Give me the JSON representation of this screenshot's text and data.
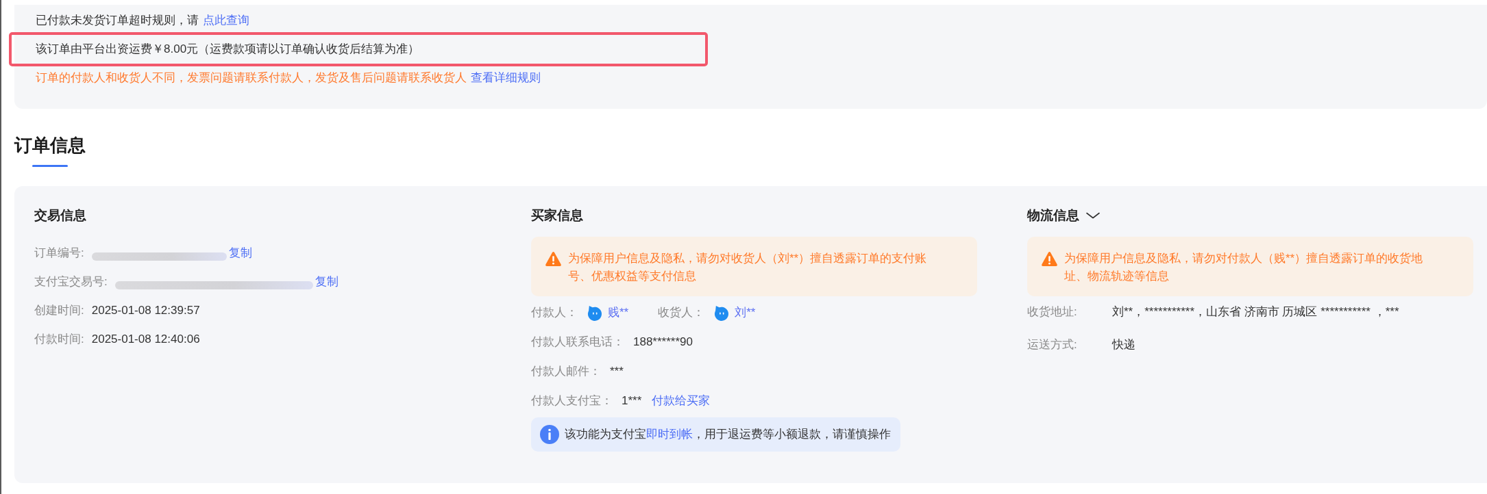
{
  "notice": {
    "lines": [
      {
        "text": "已付款未发货订单超时规则，请",
        "link": "点此查询",
        "kind": "normal",
        "highlighted": false
      },
      {
        "text": "该订单由平台出资运费￥8.00元（运费款项请以订单确认收货后结算为准）",
        "kind": "normal",
        "highlighted": true
      },
      {
        "text": "订单的付款人和收货人不同，发票问题请联系付款人，发货及售后问题请联系收货人",
        "link": "查看详细规则",
        "kind": "warning",
        "highlighted": false
      }
    ]
  },
  "section": {
    "title": "订单信息"
  },
  "trade_info": {
    "title": "交易信息",
    "rows": [
      {
        "label": "订单编号:",
        "redacted": true,
        "action": "复制"
      },
      {
        "label": "支付宝交易号:",
        "redacted": true,
        "action": "复制"
      },
      {
        "label": "创建时间:",
        "redacted": false,
        "value": "2025-01-08 12:39:57"
      },
      {
        "label": "付款时间:",
        "redacted": false,
        "value": "2025-01-08 12:40:06"
      }
    ]
  },
  "buyer_info": {
    "title": "买家信息",
    "warning": "为保障用户信息及隐私，请勿对收货人（刘**）擅自透露订单的支付账号、优惠权益等支付信息",
    "parties": [
      {
        "label": "付款人：",
        "name": "贱**"
      },
      {
        "label": "收货人：",
        "name": "刘**"
      }
    ],
    "rows": [
      {
        "label": "付款人联系电话：",
        "value": "188******90"
      },
      {
        "label": "付款人邮件：",
        "value": "***"
      },
      {
        "label": "付款人支付宝：",
        "value": "1***",
        "link": "付款给买家"
      }
    ],
    "info": {
      "text_before": "该功能为支付宝",
      "link": "即时到帐",
      "text_after": "，用于退运费等小额退款，请谨慎操作"
    }
  },
  "logistics_info": {
    "title": "物流信息",
    "warning": "为保障用户信息及隐私，请勿对付款人（贱**）擅自透露订单的收货地址、物流轨迹等信息",
    "rows": [
      {
        "label": "收货地址:",
        "value": "刘**，***********，山东省 济南市 历城区 *********** ，***"
      },
      {
        "label": "运送方式:",
        "value": "快递"
      }
    ]
  }
}
